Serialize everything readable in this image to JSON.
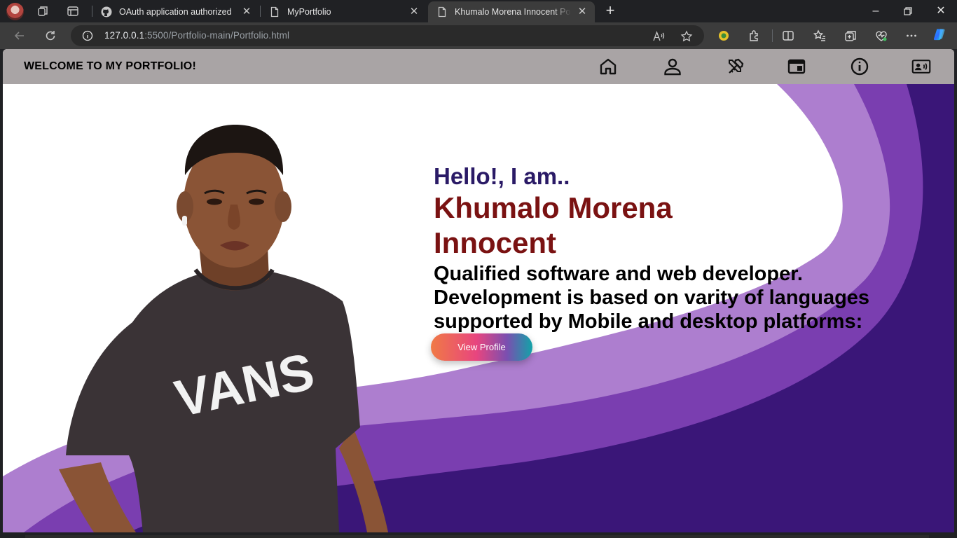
{
  "browser": {
    "tabs": [
      {
        "title": "OAuth application authorized",
        "favicon": "github-icon"
      },
      {
        "title": "MyPortfolio",
        "favicon": "page-icon"
      },
      {
        "title": "Khumalo Morena Innocent Portfolio",
        "favicon": "page-icon",
        "active": true
      }
    ],
    "address": {
      "host": "127.0.0.1",
      "path": ":5500/Portfolio-main/Portfolio.html"
    }
  },
  "site": {
    "header_title": "WELCOME TO MY PORTFOLIO!",
    "nav_icons": [
      "home-icon",
      "user-icon",
      "tools-icon",
      "browser-window-icon",
      "info-icon",
      "contact-card-icon"
    ],
    "greeting": "Hello!, I am..",
    "name": "Khumalo Morena Innocent",
    "tagline": "Qualified software and web developer. Development is based on varity of languages supported by Mobile and desktop platforms:",
    "button_label": "View Profile",
    "shirt_text": "VANS"
  },
  "colors": {
    "greeting": "#2a1a66",
    "name": "#7a1212",
    "wave_light": "#b07fd4",
    "wave_mid": "#8a4dbf",
    "wave_dark": "#3c1676"
  }
}
